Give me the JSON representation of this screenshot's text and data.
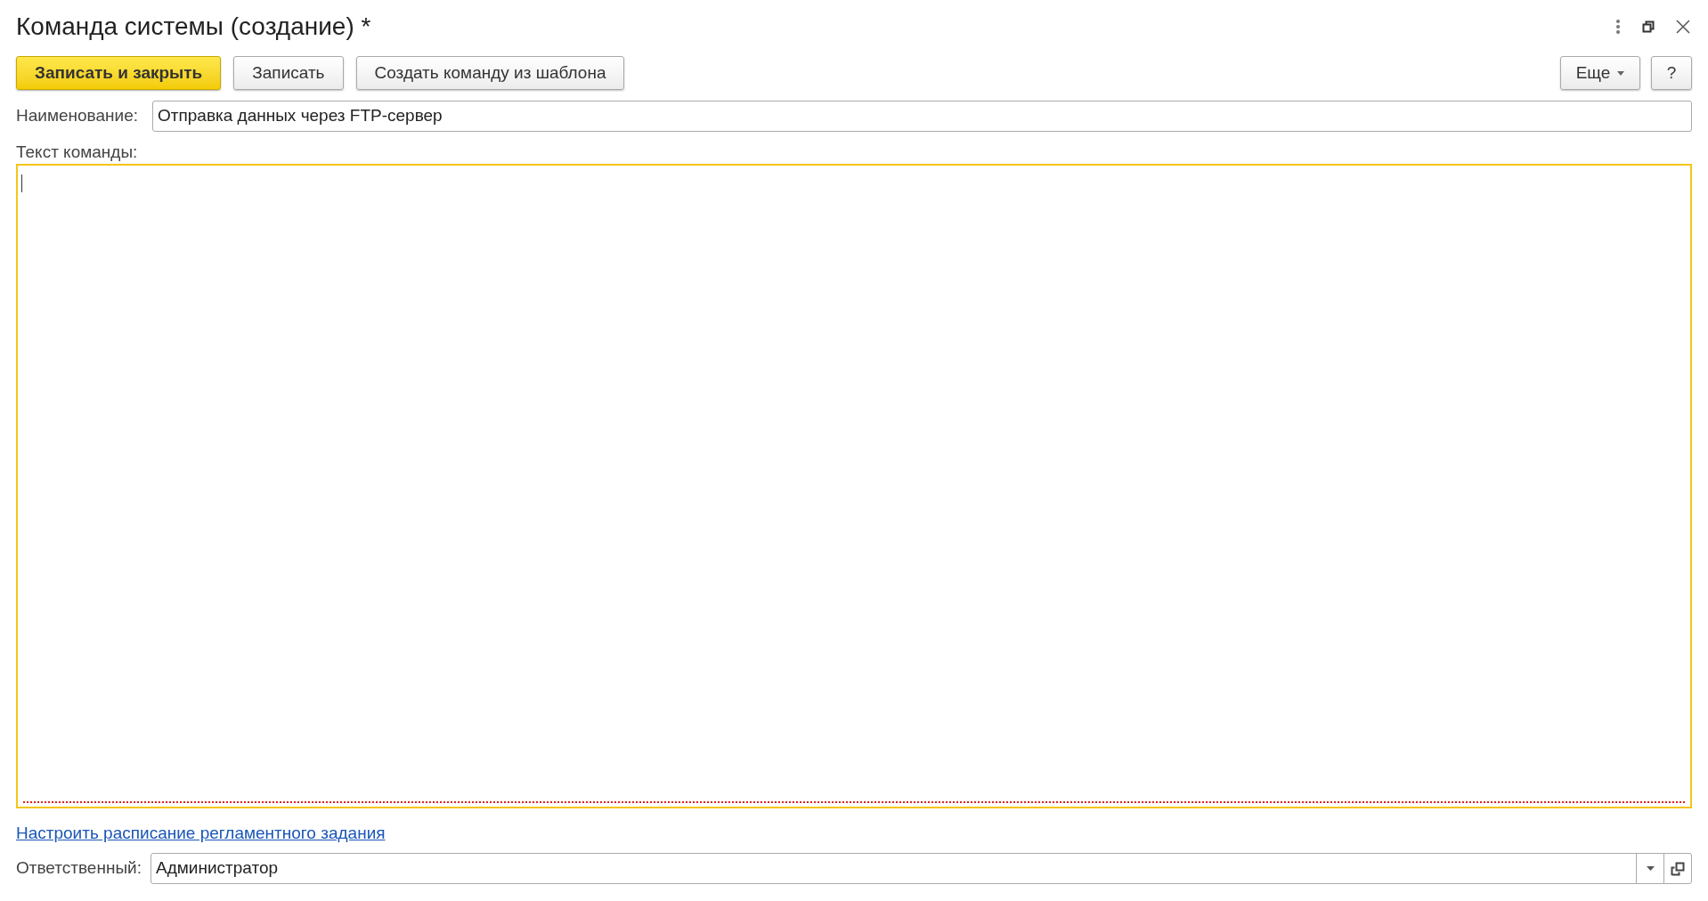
{
  "window": {
    "title": "Команда системы (создание) *"
  },
  "toolbar": {
    "buttons": [
      {
        "label": "Записать и закрыть",
        "kind": "primary"
      },
      {
        "label": "Записать",
        "kind": "normal"
      },
      {
        "label": "Создать команду из шаблона",
        "kind": "normal"
      }
    ],
    "more": {
      "label": "Еще"
    },
    "help": {
      "label": "?"
    }
  },
  "name_field": {
    "label": "Наименование:",
    "value": "Отправка данных через FTP-сервер"
  },
  "command_text": {
    "label": "Текст команды:",
    "focused": true,
    "required_empty": true
  },
  "schedule_link": "Настроить расписание регламентного задания",
  "responsible_field": {
    "label": "Ответственный:",
    "value": "Администратор"
  }
}
